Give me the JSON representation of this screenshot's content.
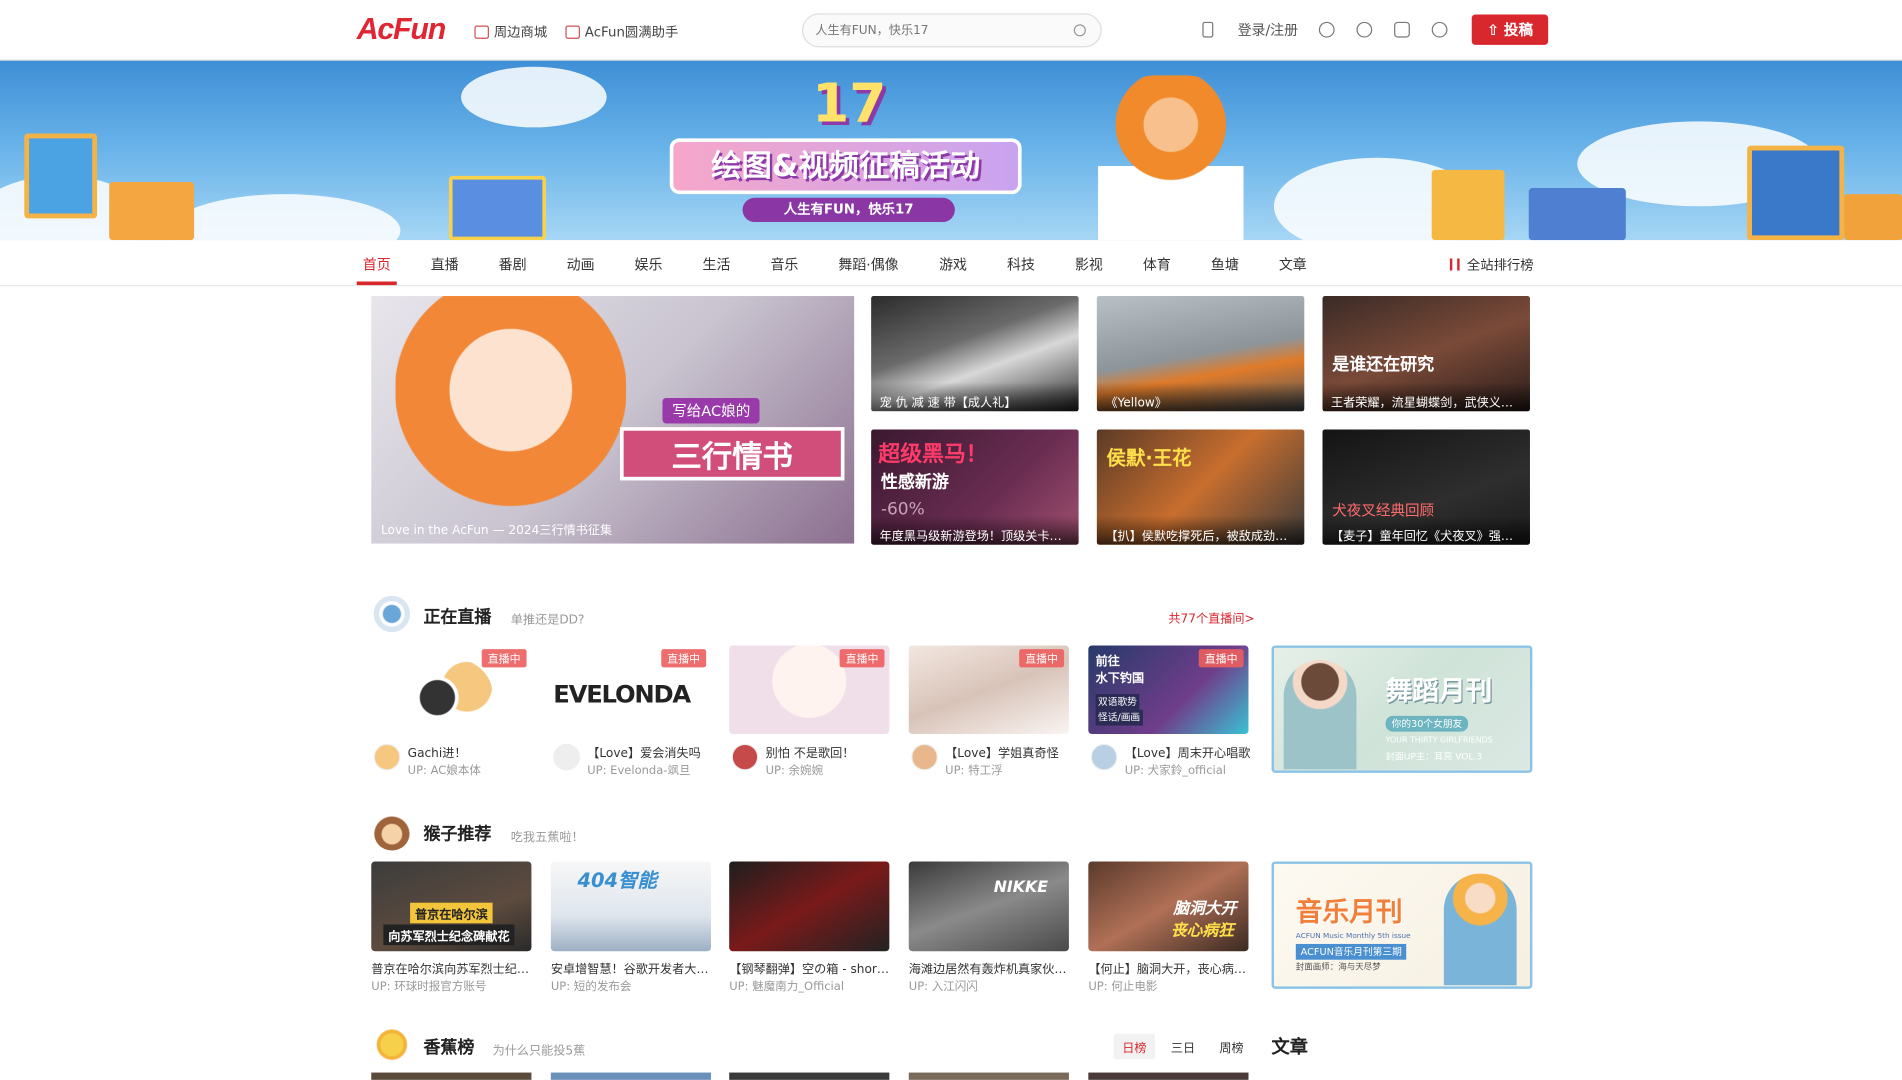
{
  "header": {
    "logo": "AcFun",
    "link1": "周边商城",
    "link2": "AcFun圆满助手",
    "search_placeholder": "人生有FUN，快乐17",
    "login": "登录/注册",
    "upload": "投稿"
  },
  "banner": {
    "num": "17",
    "title": "绘图&视频征稿活动",
    "subtitle": "人生有FUN，快乐17"
  },
  "nav": {
    "items": [
      "首页",
      "直播",
      "番剧",
      "动画",
      "娱乐",
      "生活",
      "音乐",
      "舞蹈·偶像",
      "游戏",
      "科技",
      "影视",
      "体育",
      "鱼塘",
      "文章"
    ],
    "rank": "全站排行榜"
  },
  "hero": {
    "tag": "写给AC娘的",
    "title": "三行情书",
    "caption": "Love in the AcFun — 2024三行情书征集"
  },
  "feature": [
    "宠 仇 减 速 带【成人礼】",
    "《Yellow》",
    "王者荣耀，流星蝴蝶剑，武侠义…",
    "年度黑马级新游登场！顶级关卡…",
    "【扒】侯默吃撑死后，被敌成劲劳…",
    "【麦子】童年回忆《犬夜叉》强气…"
  ],
  "feature_text": {
    "f3": "是谁还在研究",
    "f4a": "超级黑马！",
    "f4b": "性感新游",
    "f4c": "-60%",
    "f5": "侯默·王花",
    "f6": "犬夜叉经典回顾"
  },
  "live": {
    "title": "正在直播",
    "sub": "单推还是DD?",
    "more": "共77个直播间>",
    "badge": "直播中",
    "items": [
      {
        "t": "Gachi进！",
        "u": "UP: AC娘本体"
      },
      {
        "t": "【Love】爱会消失吗",
        "u": "UP: Evelonda-飒旦"
      },
      {
        "t": "别怕 不是歌回！",
        "u": "UP: 余婉婉"
      },
      {
        "t": "【Love】学姐真奇怪",
        "u": "UP: 特工浮"
      },
      {
        "t": "【Love】周末开心唱歌",
        "u": "UP: 犬家鈴_official"
      }
    ],
    "ev": "EVELONDA",
    "f5a": "前往",
    "f5b": "水下钓国",
    "f5c": "双语歌势",
    "f5d": "怪话/画画"
  },
  "promo1": {
    "title": "舞蹈月刊",
    "sub": "你的30个女朋友",
    "line2": "YOUR THIRTY GIRLFRIENDS",
    "vol": "封面UP主：耳亮  VOL.3"
  },
  "monkey": {
    "title": "猴子推荐",
    "sub": "吃我五蕉啦！",
    "items": [
      {
        "t": "普京在哈尔滨向苏军烈士纪…",
        "u": "UP: 环球时报官方账号"
      },
      {
        "t": "安卓增智慧！谷歌开发者大…",
        "u": "UP: 短的发布会"
      },
      {
        "t": "【钢琴翻弹】空の箱 - short …",
        "u": "UP: 魅魔南力_Official"
      },
      {
        "t": "海滩边居然有轰炸机真家伙…",
        "u": "UP: 入江闪闪"
      },
      {
        "t": "【何止】脑洞大开，丧心病狂…",
        "u": "UP: 何止电影"
      }
    ],
    "t1a": "普京在哈尔滨",
    "t1b": "向苏军烈士纪念碑献花",
    "t2": "404智能",
    "t4": "NIKKE",
    "t5a": "脑洞大开",
    "t5b": "丧心病狂"
  },
  "promo2": {
    "title": "音乐月刊",
    "line1": "ACFUN Music Monthly 5th issue",
    "line2": "ACFUN音乐月刊第三期",
    "line3": "封面画师：海与天尽梦"
  },
  "banana": {
    "title": "香蕉榜",
    "sub": "为什么只能投5蕉",
    "tabs": [
      "日榜",
      "三日",
      "周榜"
    ]
  },
  "article": {
    "title": "文章"
  },
  "colors": {
    "accent": "#d9272e"
  }
}
